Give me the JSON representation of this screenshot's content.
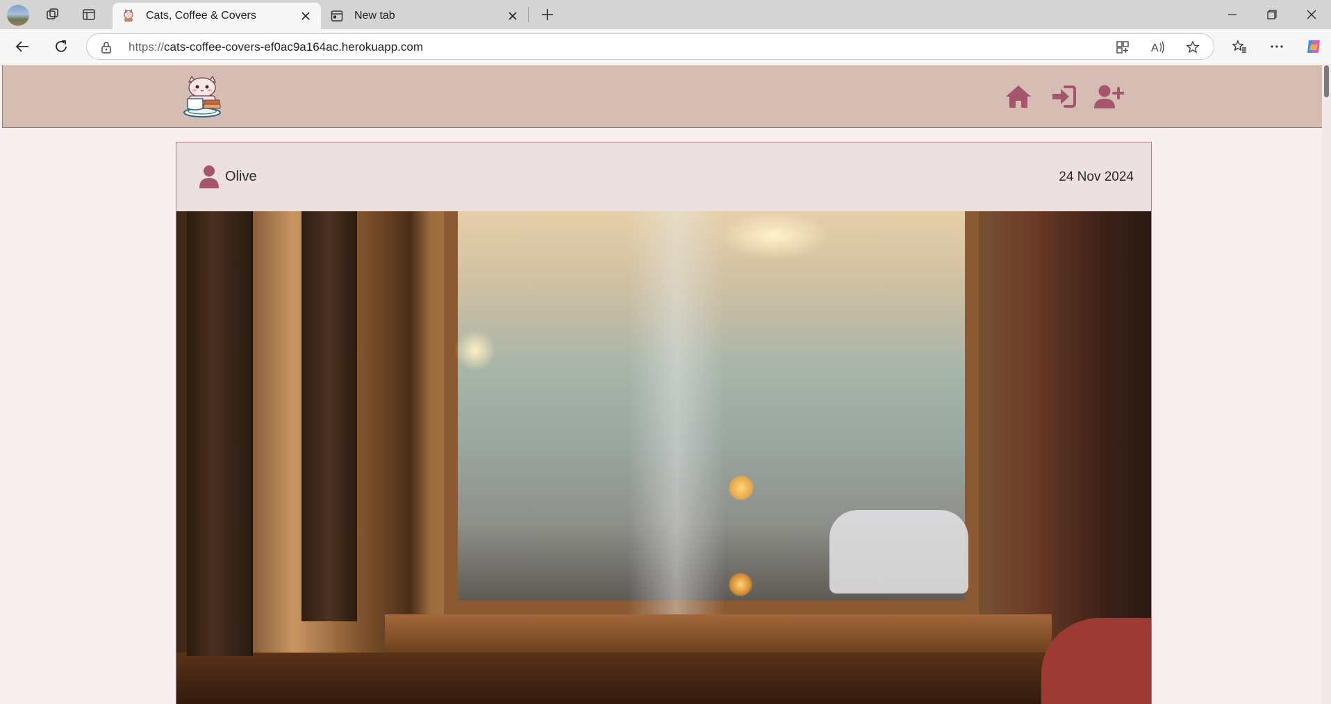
{
  "browser": {
    "tabs": [
      {
        "title": "Cats, Coffee & Covers",
        "active": true
      },
      {
        "title": "New tab",
        "active": false
      }
    ],
    "url": {
      "scheme": "https://",
      "host": "cats-coffee-covers-ef0ac9a164ac.herokuapp.com"
    },
    "icons": {
      "profile": "profile-avatar",
      "workspaces": "workspaces-icon",
      "tab_actions": "vertical-tabs-icon",
      "new_tab": "plus-icon",
      "back": "back-arrow-icon",
      "refresh": "refresh-icon",
      "lock": "lock-icon",
      "app": "app-grid-icon",
      "read_aloud": "read-aloud-icon",
      "favorite": "star-icon",
      "favorites": "favorites-icon",
      "more": "more-icon",
      "copilot": "copilot-icon"
    }
  },
  "site": {
    "colors": {
      "navbar": "#d6bdb4",
      "accent": "#a4566e",
      "page": "#f7eeef",
      "card": "#ece0e1"
    },
    "nav": {
      "home": "home-icon",
      "login": "sign-in-icon",
      "register": "user-plus-icon"
    }
  },
  "post": {
    "author": "Olive",
    "date": "24 Nov 2024"
  }
}
